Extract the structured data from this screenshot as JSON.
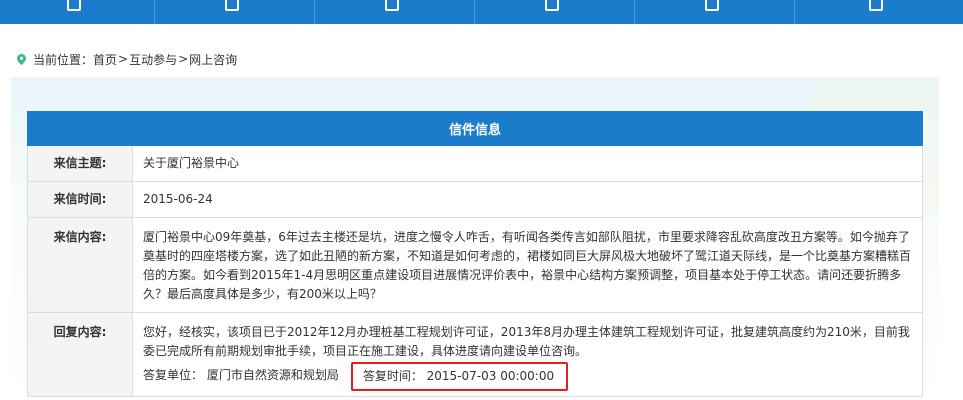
{
  "nav": {
    "items": [
      {
        "label": "",
        "icon": "home-icon"
      },
      {
        "label": "",
        "icon": "chart-icon"
      },
      {
        "label": "",
        "icon": "hand-icon"
      },
      {
        "label": "",
        "icon": "chat-icon"
      },
      {
        "label": "",
        "icon": "document-icon"
      },
      {
        "label": "",
        "icon": "gear-icon"
      }
    ]
  },
  "breadcrumb": {
    "prefix": "当前位置：",
    "items": [
      "首页",
      "互动参与",
      "网上咨询"
    ],
    "separator": ">"
  },
  "letter": {
    "heading": "信件信息",
    "subject_label": "来信主题:",
    "subject_value": "关于厦门裕景中心",
    "date_label": "来信时间:",
    "date_value": "2015-06-24",
    "content_label": "来信内容:",
    "content_value": "厦门裕景中心09年奠基，6年过去主楼还是坑，进度之慢令人咋舌，有听闻各类传言如部队阻扰，市里要求降容乱砍高度改丑方案等。如今抛弃了奠基时的四座塔楼方案，选了如此丑陋的新方案，不知道是如何考虑的，裙楼如同巨大屏风极大地破坏了鹭江道天际线，是一个比奠基方案糟糕百倍的方案。如今看到2015年1-4月思明区重点建设项目进展情况评价表中，裕景中心结构方案预调整，项目基本处于停工状态。请问还要折腾多久？最后高度具体是多少，有200米以上吗？",
    "reply_label": "回复内容:",
    "reply_value": "您好，经核实，该项目已于2012年12月办理桩基工程规划许可证，2013年8月办理主体建筑工程规划许可证，批复建筑高度约为210米，目前我委已完成所有前期规划审批手续，项目正在施工建设，具体进度请向建设单位咨询。",
    "reply_unit": "答复单位：  厦门市自然资源和规划局",
    "reply_time": "答复时间：  2015-07-03 00:00:00"
  },
  "colors": {
    "nav_blue": "#1a7ccb",
    "highlight_red": "#e0201b",
    "pin_green": "#3dbb8a"
  }
}
